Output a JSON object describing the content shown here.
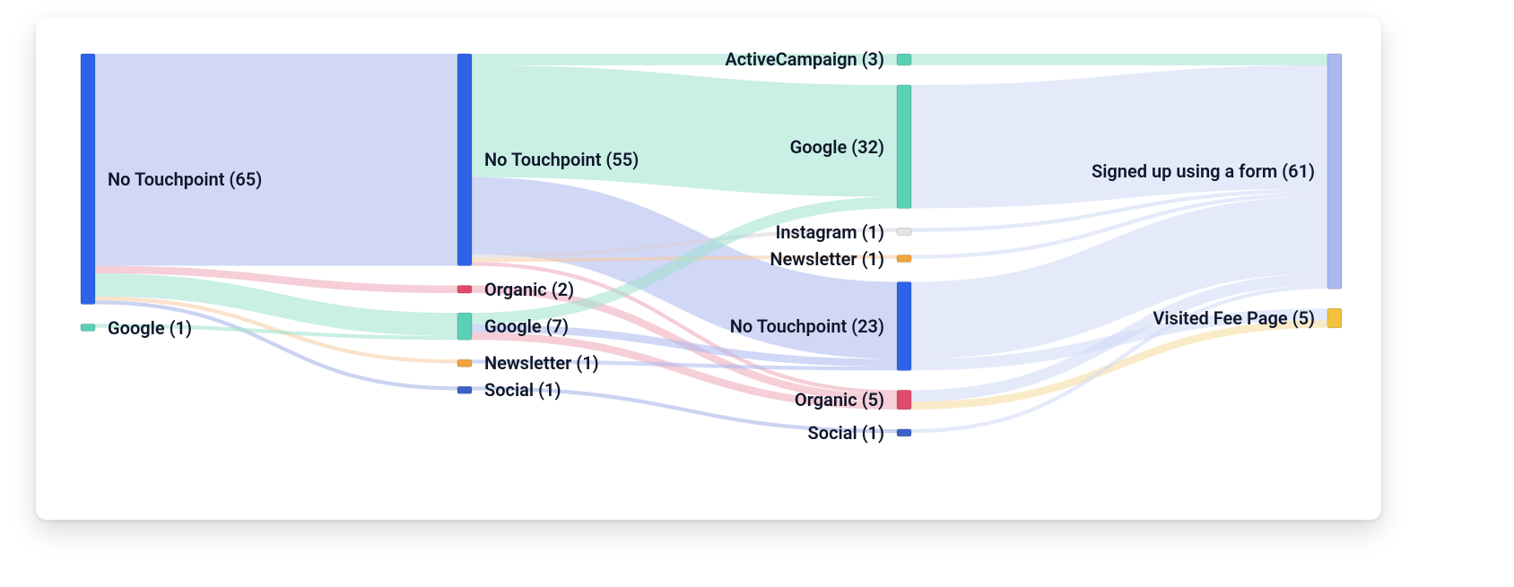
{
  "chart_data": {
    "type": "sankey",
    "title": "",
    "stages": [
      {
        "index": 0,
        "nodes": [
          {
            "id": "s0_notouch",
            "label": "No Touchpoint",
            "value": 65,
            "color": "#2e63e7"
          },
          {
            "id": "s0_google",
            "label": "Google",
            "value": 1,
            "color": "#5ad0b4"
          }
        ]
      },
      {
        "index": 1,
        "nodes": [
          {
            "id": "s1_notouch",
            "label": "No Touchpoint",
            "value": 55,
            "color": "#2e63e7"
          },
          {
            "id": "s1_organic",
            "label": "Organic",
            "value": 2,
            "color": "#e14a6b"
          },
          {
            "id": "s1_google",
            "label": "Google",
            "value": 7,
            "color": "#5ad0b4"
          },
          {
            "id": "s1_newsletter",
            "label": "Newsletter",
            "value": 1,
            "color": "#f2a33a"
          },
          {
            "id": "s1_social",
            "label": "Social",
            "value": 1,
            "color": "#3c62c9"
          }
        ]
      },
      {
        "index": 2,
        "nodes": [
          {
            "id": "s2_active",
            "label": "ActiveCampaign",
            "value": 3,
            "color": "#5ad0b4"
          },
          {
            "id": "s2_google",
            "label": "Google",
            "value": 32,
            "color": "#5ad0b4"
          },
          {
            "id": "s2_instagram",
            "label": "Instagram",
            "value": 1,
            "color": "#e7e2e4"
          },
          {
            "id": "s2_newsletter",
            "label": "Newsletter",
            "value": 1,
            "color": "#f2a33a"
          },
          {
            "id": "s2_notouch",
            "label": "No Touchpoint",
            "value": 23,
            "color": "#2e63e7"
          },
          {
            "id": "s2_organic",
            "label": "Organic",
            "value": 5,
            "color": "#e14a6b"
          },
          {
            "id": "s2_social",
            "label": "Social",
            "value": 1,
            "color": "#3c62c9"
          }
        ]
      },
      {
        "index": 3,
        "nodes": [
          {
            "id": "s3_signed",
            "label": "Signed up using a form",
            "value": 61,
            "color": "#aab8ef"
          },
          {
            "id": "s3_fee",
            "label": "Visited Fee Page",
            "value": 5,
            "color": "#f2c23a"
          }
        ]
      }
    ],
    "links": [
      {
        "source": "s0_notouch",
        "target": "s1_notouch",
        "value": 55,
        "color": "#aab8ef"
      },
      {
        "source": "s0_notouch",
        "target": "s1_organic",
        "value": 2,
        "color": "#eca6b6"
      },
      {
        "source": "s0_notouch",
        "target": "s1_google",
        "value": 6,
        "color": "#9fe1cf"
      },
      {
        "source": "s0_notouch",
        "target": "s1_newsletter",
        "value": 1,
        "color": "#f7caa0"
      },
      {
        "source": "s0_notouch",
        "target": "s1_social",
        "value": 1,
        "color": "#9fb1e6"
      },
      {
        "source": "s0_google",
        "target": "s1_google",
        "value": 1,
        "color": "#9fe1cf"
      },
      {
        "source": "s1_notouch",
        "target": "s2_active",
        "value": 3,
        "color": "#9fe1cf"
      },
      {
        "source": "s1_notouch",
        "target": "s2_google",
        "value": 29,
        "color": "#9fe1cf"
      },
      {
        "source": "s1_notouch",
        "target": "s2_notouch",
        "value": 20,
        "color": "#aab8ef"
      },
      {
        "source": "s1_notouch",
        "target": "s2_instagram",
        "value": 1,
        "color": "#d9cfd8"
      },
      {
        "source": "s1_notouch",
        "target": "s2_newsletter",
        "value": 1,
        "color": "#f7caa0"
      },
      {
        "source": "s1_notouch",
        "target": "s2_organic",
        "value": 1,
        "color": "#eca6b6"
      },
      {
        "source": "s1_organic",
        "target": "s2_organic",
        "value": 2,
        "color": "#eca6b6"
      },
      {
        "source": "s1_google",
        "target": "s2_google",
        "value": 3,
        "color": "#9fe1cf"
      },
      {
        "source": "s1_google",
        "target": "s2_notouch",
        "value": 2,
        "color": "#aab8ef"
      },
      {
        "source": "s1_google",
        "target": "s2_organic",
        "value": 2,
        "color": "#eca6b6"
      },
      {
        "source": "s1_newsletter",
        "target": "s2_notouch",
        "value": 1,
        "color": "#aab8ef"
      },
      {
        "source": "s1_social",
        "target": "s2_social",
        "value": 1,
        "color": "#9fb1e6"
      },
      {
        "source": "s2_active",
        "target": "s3_signed",
        "value": 3,
        "color": "#9fe1cf"
      },
      {
        "source": "s2_google",
        "target": "s3_signed",
        "value": 32,
        "color": "#cfd9f6"
      },
      {
        "source": "s2_instagram",
        "target": "s3_signed",
        "value": 1,
        "color": "#cfd9f6"
      },
      {
        "source": "s2_newsletter",
        "target": "s3_signed",
        "value": 1,
        "color": "#cfd9f6"
      },
      {
        "source": "s2_notouch",
        "target": "s3_signed",
        "value": 20,
        "color": "#cfd9f6"
      },
      {
        "source": "s2_notouch",
        "target": "s3_fee",
        "value": 3,
        "color": "#cfd9f6"
      },
      {
        "source": "s2_organic",
        "target": "s3_signed",
        "value": 3,
        "color": "#cfd9f6"
      },
      {
        "source": "s2_organic",
        "target": "s3_fee",
        "value": 2,
        "color": "#f5db9a"
      },
      {
        "source": "s2_social",
        "target": "s3_signed",
        "value": 1,
        "color": "#cfd9f6"
      }
    ]
  },
  "labels": {
    "s0_notouch": "No Touchpoint (65)",
    "s0_google": "Google (1)",
    "s1_notouch": "No Touchpoint (55)",
    "s1_organic": "Organic (2)",
    "s1_google": "Google (7)",
    "s1_newsletter": "Newsletter (1)",
    "s1_social": "Social (1)",
    "s2_active": "ActiveCampaign (3)",
    "s2_google": "Google (32)",
    "s2_instagram": "Instagram (1)",
    "s2_newsletter": "Newsletter (1)",
    "s2_notouch": "No Touchpoint (23)",
    "s2_organic": "Organic (5)",
    "s2_social": "Social (1)",
    "s3_signed": "Signed up using a form (61)",
    "s3_fee": "Visited Fee Page (5)"
  }
}
